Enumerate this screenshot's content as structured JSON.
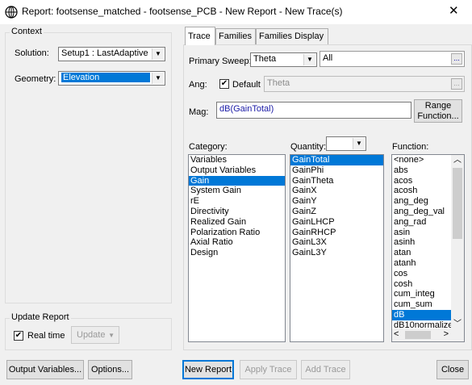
{
  "window": {
    "title": "Report: footsense_matched - footsense_PCB - New Report - New Trace(s)"
  },
  "context": {
    "group_label": "Context",
    "solution_label": "Solution:",
    "solution_value": "Setup1 : LastAdaptive",
    "geometry_label": "Geometry:",
    "geometry_value": "Elevation"
  },
  "update_report": {
    "group_label": "Update Report",
    "realtime_label": "Real time",
    "realtime_checked": true,
    "update_button": "Update"
  },
  "tabs": [
    {
      "label": "Trace",
      "active": true
    },
    {
      "label": "Families",
      "active": false
    },
    {
      "label": "Families Display",
      "active": false
    }
  ],
  "trace": {
    "primary_sweep_label": "Primary Sweep:",
    "primary_sweep_value": "Theta",
    "primary_sweep_range": "All",
    "ang_label": "Ang:",
    "default_label": "Default",
    "default_checked": true,
    "ang_value": "Theta",
    "mag_label": "Mag:",
    "mag_value": "dB(GainTotal)",
    "range_function_button": "Range Function...",
    "ellipsis": "..."
  },
  "category": {
    "label": "Category:",
    "items": [
      "Variables",
      "Output Variables",
      "Gain",
      "System Gain",
      "rE",
      "Directivity",
      "Realized Gain",
      "Polarization Ratio",
      "Axial Ratio",
      "Design"
    ],
    "selected_index": 2
  },
  "quantity": {
    "label": "Quantity:",
    "filter_value": "",
    "items": [
      "GainTotal",
      "GainPhi",
      "GainTheta",
      "GainX",
      "GainY",
      "GainZ",
      "GainLHCP",
      "GainRHCP",
      "GainL3X",
      "GainL3Y"
    ],
    "selected_index": 0
  },
  "function": {
    "label": "Function:",
    "items": [
      "<none>",
      "abs",
      "acos",
      "acosh",
      "ang_deg",
      "ang_deg_val",
      "ang_rad",
      "asin",
      "asinh",
      "atan",
      "atanh",
      "cos",
      "cosh",
      "cum_integ",
      "cum_sum",
      "dB",
      "dB10normalize"
    ],
    "selected_index": 15
  },
  "bottom_buttons": {
    "output_variables": "Output Variables...",
    "options": "Options...",
    "new_report": "New Report",
    "apply_trace": "Apply Trace",
    "add_trace": "Add Trace",
    "close": "Close"
  },
  "colors": {
    "selection": "#0078d7",
    "window_bg": "#f0f0f0",
    "mag_text": "#1a1aa6"
  }
}
